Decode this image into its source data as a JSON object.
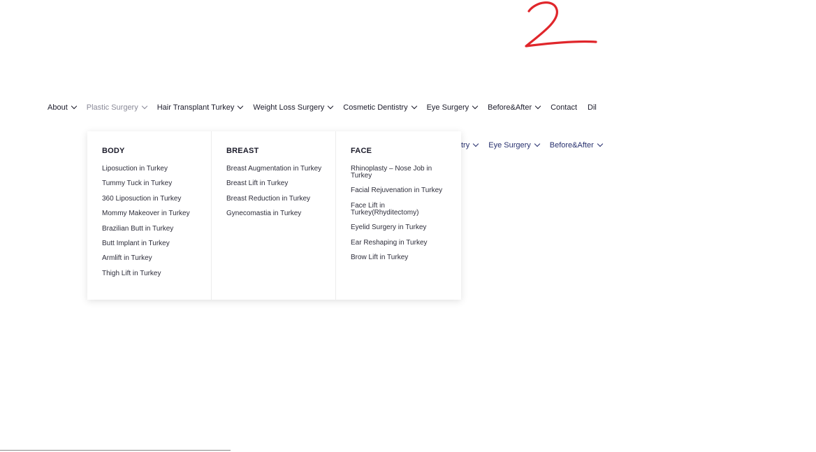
{
  "annotation": {
    "text": "2",
    "color": "#e0262b"
  },
  "nav": {
    "items": [
      {
        "label": "About",
        "has_menu": true
      },
      {
        "label": "Plastic Surgery",
        "has_menu": true,
        "active": true
      },
      {
        "label": "Hair Transplant Turkey",
        "has_menu": true
      },
      {
        "label": "Weight Loss Surgery",
        "has_menu": true
      },
      {
        "label": "Cosmetic Dentistry",
        "has_menu": true
      },
      {
        "label": "Eye Surgery",
        "has_menu": true
      },
      {
        "label": "Before&After",
        "has_menu": true
      },
      {
        "label": "Contact",
        "has_menu": false
      },
      {
        "label": "Dil",
        "has_menu": false
      }
    ]
  },
  "ghost_nav": {
    "items": [
      {
        "label": "try"
      },
      {
        "label": "Eye Surgery"
      },
      {
        "label": "Before&After"
      }
    ]
  },
  "mega_menu": {
    "columns": [
      {
        "title": "BODY",
        "links": [
          "Liposuction in Turkey",
          "Tummy Tuck in Turkey",
          "360 Liposuction in Turkey",
          "Mommy Makeover in Turkey",
          "Brazilian Butt in Turkey",
          "Butt Implant in Turkey",
          "Armlift in Turkey",
          "Thigh Lift in Turkey"
        ]
      },
      {
        "title": "BREAST",
        "links": [
          "Breast Augmentation in Turkey",
          "Breast Lift in Turkey",
          "Breast Reduction in Turkey",
          "Gynecomastia in Turkey"
        ]
      },
      {
        "title": "FACE",
        "links": [
          "Rhinoplasty – Nose Job in Turkey",
          "Facial Rejuvenation in Turkey",
          "Face Lift in Turkey(Rhyditectomy)",
          "Eyelid Surgery in Turkey",
          "Ear Reshaping in Turkey",
          "Brow Lift in Turkey"
        ]
      }
    ]
  }
}
